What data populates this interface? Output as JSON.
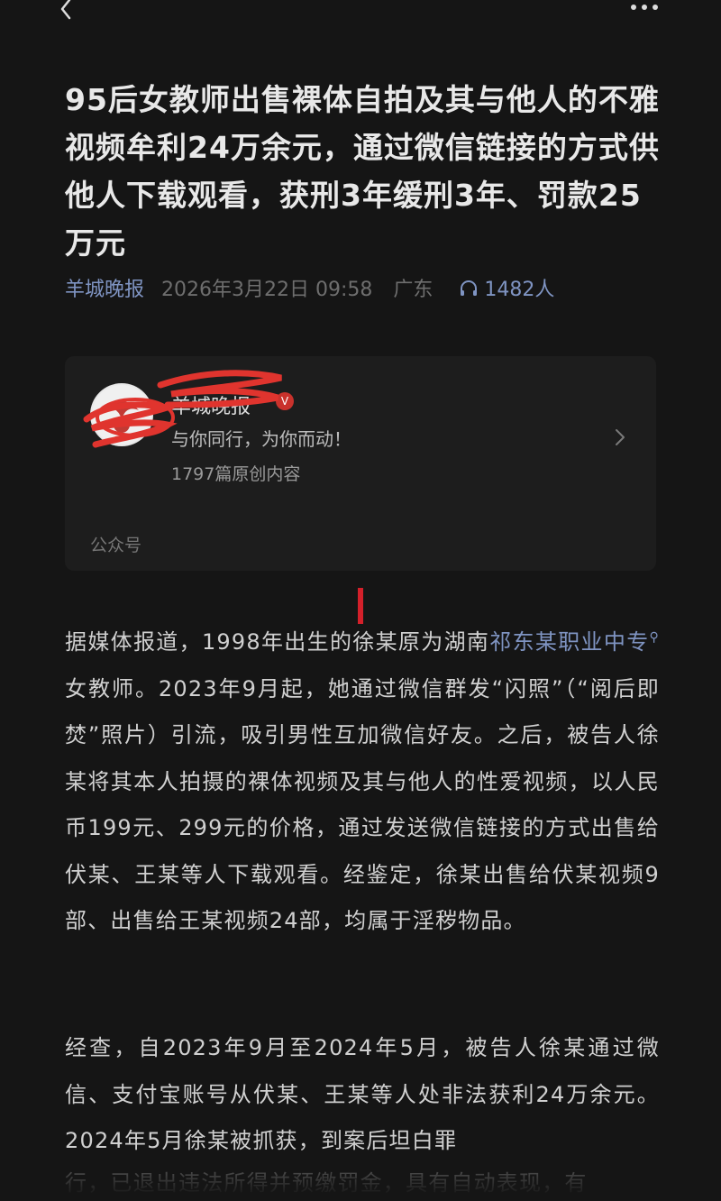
{
  "nav": {
    "back_icon": "chevron-left-icon",
    "more_icon": "more-dots-icon"
  },
  "article": {
    "title": "95后女教师出售裸体自拍及其与他人的不雅视频牟利24万余元，通过微信链接的方式供他人下载观看，获刑3年缓刑3年、罚款25万元",
    "source": "羊城晚报",
    "date": "2026年3月22日 09:58",
    "location": "广东",
    "listeners": "1482人"
  },
  "account_card": {
    "name": "羊城晚报",
    "verified": "V",
    "slogan": "与你同行，为你而动！",
    "count": "1797篇原创内容",
    "type": "公众号"
  },
  "body": {
    "p1_part1": "据媒体报道，1998年出生的徐某原为湖南",
    "p1_link": "祁东某职业中专",
    "p1_part2": "女教师。2023年9月起，她通过微信群发“闪照”（“阅后即焚”照片）引流，吸引男性互加微信好友。之后，被告人徐某将其本人拍摄的裸体视频及其与他人的性爱视频，以人民币199元、299元的价格，通过发送微信链接的方式出售给伏某、王某等人下载观看。经鉴定，徐某出售给伏某视频9部、出售给王某视频24部，均属于淫秽物品。",
    "p2": "经查，自2023年9月至2024年5月，被告人徐某通过微信、支付宝账号从伏某、王某等人处非法获利24万余元。 2024年5月徐某被抓获，到案后坦白罪",
    "p2_cut": "行，已退出违法所得并预缴罚金，具有自动表现，有"
  },
  "colors": {
    "background": "#151515",
    "link": "#7f94c2",
    "accent_red": "#d4202a"
  }
}
